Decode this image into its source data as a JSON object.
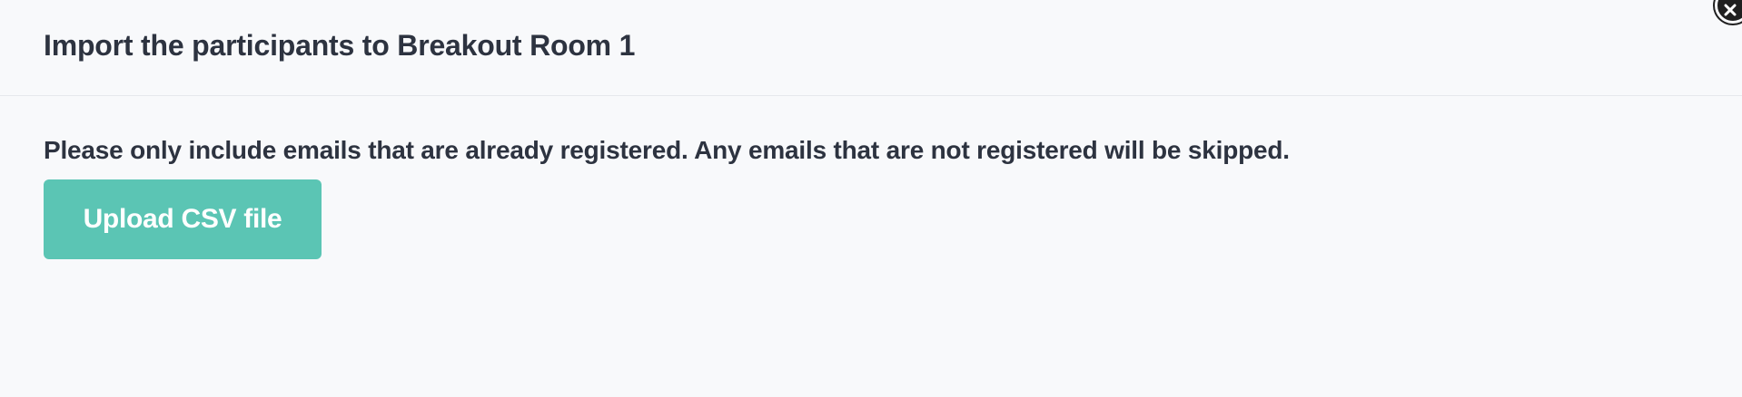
{
  "modal": {
    "title": "Import the participants to Breakout Room 1",
    "instructions": "Please only include emails that are already registered. Any emails that are not registered will be skipped.",
    "upload_button_label": "Upload CSV file",
    "close_icon": "close-icon",
    "accent_color": "#5bc5b4"
  }
}
